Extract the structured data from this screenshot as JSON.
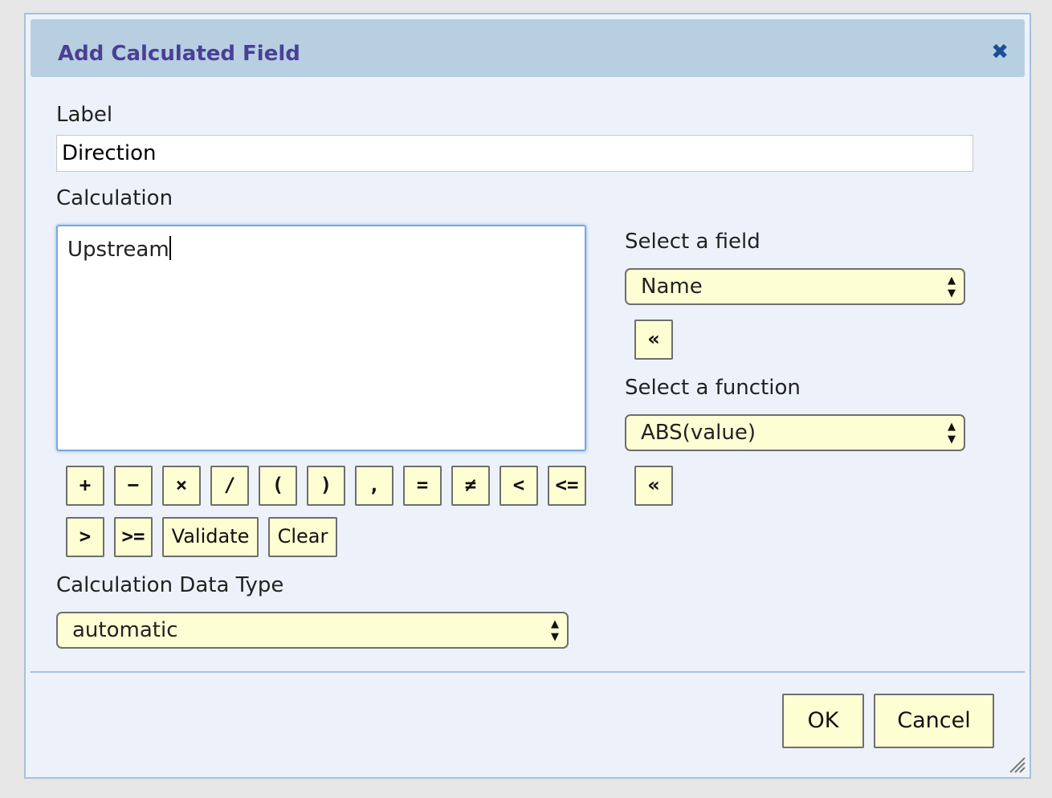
{
  "dialog": {
    "title": "Add Calculated Field",
    "close_icon": "close-icon"
  },
  "label_field": {
    "label": "Label",
    "value": "Direction"
  },
  "calculation": {
    "label": "Calculation",
    "value": "Upstream"
  },
  "operators": [
    "+",
    "−",
    "×",
    "/",
    "(",
    ")",
    ",",
    "=",
    "≠",
    "<",
    "<=",
    ">",
    ">="
  ],
  "actions": {
    "validate": "Validate",
    "clear": "Clear"
  },
  "field_select": {
    "label": "Select a field",
    "value": "Name",
    "insert_label": "«"
  },
  "function_select": {
    "label": "Select a function",
    "value": "ABS(value)",
    "insert_label": "«"
  },
  "data_type": {
    "label": "Calculation Data Type",
    "value": "automatic"
  },
  "footer": {
    "ok": "OK",
    "cancel": "Cancel"
  },
  "colors": {
    "title": "#4a3f96",
    "titlebar": "#b7cfe1",
    "button_bg": "#fdfed2",
    "focus_border": "#79a8e0"
  }
}
